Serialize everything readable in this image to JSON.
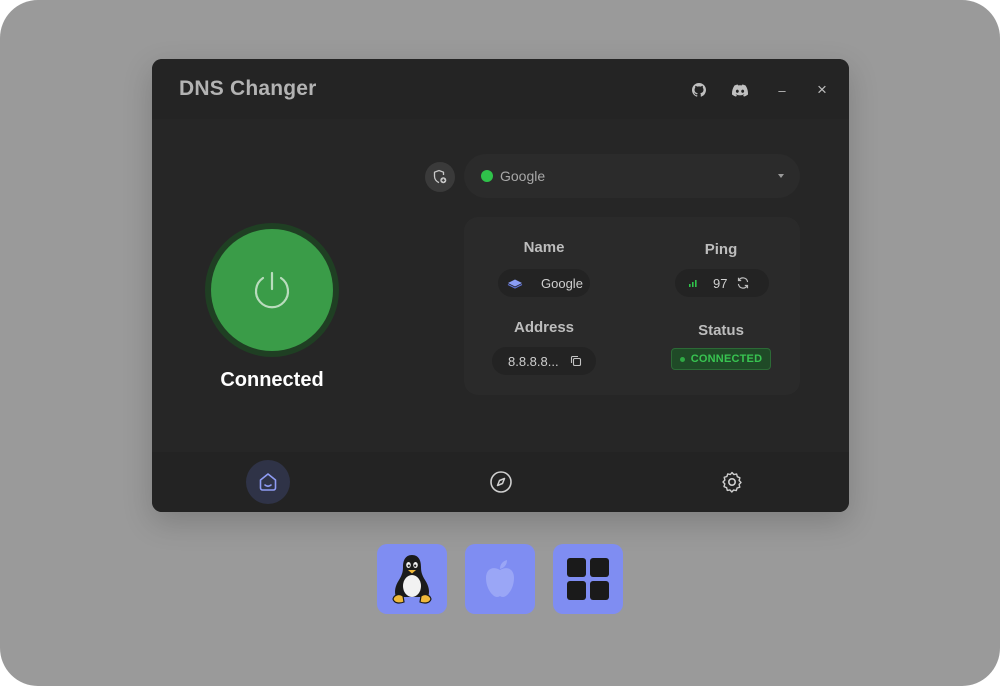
{
  "app": {
    "title": "DNS Changer",
    "titlebar_icons": [
      "github-icon",
      "discord-icon",
      "minimize-icon",
      "close-icon"
    ],
    "minimize_glyph": "–",
    "close_glyph": "×"
  },
  "connection": {
    "status_label": "Connected",
    "power_color": "#3a9c48"
  },
  "dns_select": {
    "selected": "Google",
    "status_color": "#2fc24a"
  },
  "info": {
    "name_heading": "Name",
    "name_value": "Google",
    "ping_heading": "Ping",
    "ping_value": "97",
    "address_heading": "Address",
    "address_value": "8.8.8.8...",
    "status_heading": "Status",
    "status_value": "CONNECTED"
  },
  "nav": {
    "items": [
      {
        "icon": "home-icon",
        "active": true
      },
      {
        "icon": "compass-icon",
        "active": false
      },
      {
        "icon": "gear-icon",
        "active": false
      }
    ]
  },
  "platforms": [
    "linux-icon",
    "apple-icon",
    "windows-icon"
  ],
  "colors": {
    "accent": "#7f8df2",
    "success": "#38c451",
    "window_bg": "#262626"
  }
}
